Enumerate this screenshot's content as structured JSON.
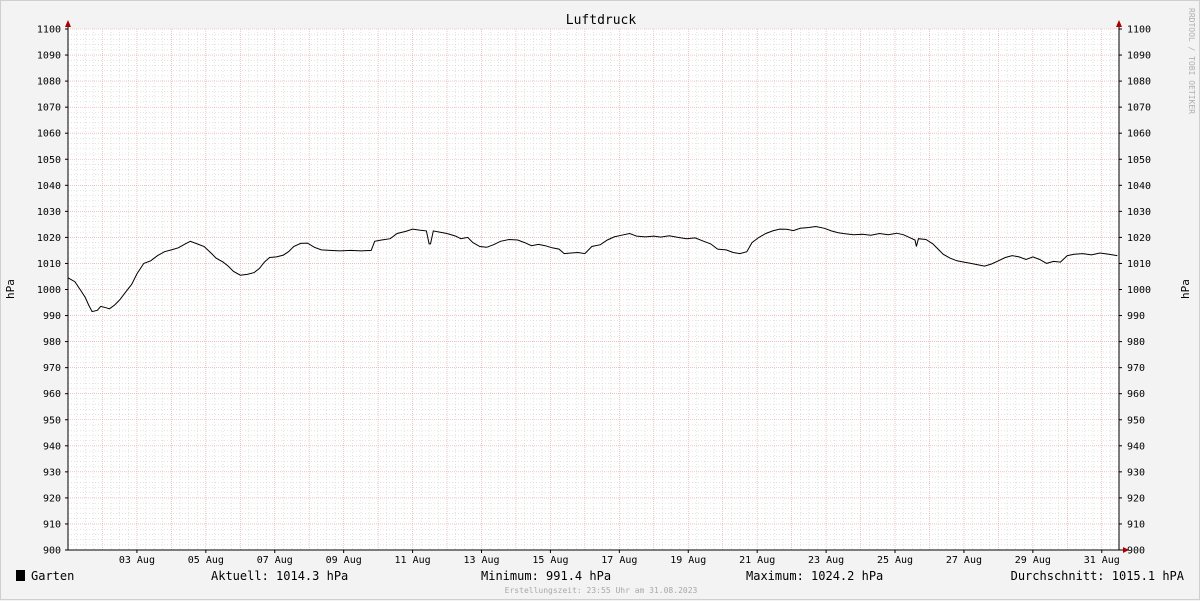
{
  "chart_data": {
    "type": "line",
    "title": "Luftdruck",
    "ylabel_left": "hPa",
    "ylabel_right": "hPa",
    "ylim": [
      900,
      1100
    ],
    "y_ticks": [
      900,
      910,
      920,
      930,
      940,
      950,
      960,
      970,
      980,
      990,
      1000,
      1010,
      1020,
      1030,
      1040,
      1050,
      1060,
      1070,
      1080,
      1090,
      1100
    ],
    "x_ticks": [
      {
        "day": 3,
        "label": "03 Aug"
      },
      {
        "day": 5,
        "label": "05 Aug"
      },
      {
        "day": 7,
        "label": "07 Aug"
      },
      {
        "day": 9,
        "label": "09 Aug"
      },
      {
        "day": 11,
        "label": "11 Aug"
      },
      {
        "day": 13,
        "label": "13 Aug"
      },
      {
        "day": 15,
        "label": "15 Aug"
      },
      {
        "day": 17,
        "label": "17 Aug"
      },
      {
        "day": 19,
        "label": "19 Aug"
      },
      {
        "day": 21,
        "label": "21 Aug"
      },
      {
        "day": 23,
        "label": "23 Aug"
      },
      {
        "day": 25,
        "label": "25 Aug"
      },
      {
        "day": 27,
        "label": "27 Aug"
      },
      {
        "day": 29,
        "label": "29 Aug"
      },
      {
        "day": 31,
        "label": "31 Aug"
      }
    ],
    "xlim_days": [
      1.0,
      31.5
    ],
    "grid": true,
    "series": [
      {
        "name": "Garten",
        "color": "#000000",
        "points": [
          [
            1.0,
            1004.5
          ],
          [
            1.2,
            1003
          ],
          [
            1.35,
            1000
          ],
          [
            1.5,
            997
          ],
          [
            1.6,
            994
          ],
          [
            1.7,
            991.5
          ],
          [
            1.85,
            992
          ],
          [
            1.95,
            993.5
          ],
          [
            2.1,
            993
          ],
          [
            2.2,
            992.6
          ],
          [
            2.35,
            994
          ],
          [
            2.5,
            996
          ],
          [
            2.7,
            999.5
          ],
          [
            2.85,
            1002
          ],
          [
            3.0,
            1006
          ],
          [
            3.2,
            1010
          ],
          [
            3.4,
            1011
          ],
          [
            3.6,
            1013
          ],
          [
            3.8,
            1014.5
          ],
          [
            4.0,
            1015.2
          ],
          [
            4.2,
            1016
          ],
          [
            4.4,
            1017.5
          ],
          [
            4.55,
            1018.5
          ],
          [
            4.75,
            1017.5
          ],
          [
            4.95,
            1016.5
          ],
          [
            5.15,
            1014
          ],
          [
            5.3,
            1012
          ],
          [
            5.5,
            1010.5
          ],
          [
            5.65,
            1009
          ],
          [
            5.8,
            1007
          ],
          [
            6.0,
            1005.5
          ],
          [
            6.2,
            1005.8
          ],
          [
            6.4,
            1006.5
          ],
          [
            6.55,
            1008
          ],
          [
            6.7,
            1010.5
          ],
          [
            6.85,
            1012.3
          ],
          [
            7.05,
            1012.5
          ],
          [
            7.25,
            1013.2
          ],
          [
            7.4,
            1014.5
          ],
          [
            7.55,
            1016.5
          ],
          [
            7.75,
            1017.7
          ],
          [
            7.95,
            1017.8
          ],
          [
            8.15,
            1016.2
          ],
          [
            8.35,
            1015.2
          ],
          [
            8.6,
            1015.0
          ],
          [
            8.9,
            1014.8
          ],
          [
            9.2,
            1015
          ],
          [
            9.5,
            1014.8
          ],
          [
            9.8,
            1015
          ],
          [
            9.9,
            1018.5
          ],
          [
            10.1,
            1019
          ],
          [
            10.35,
            1019.5
          ],
          [
            10.55,
            1021.5
          ],
          [
            10.8,
            1022.3
          ],
          [
            11.0,
            1023.2
          ],
          [
            11.2,
            1022.8
          ],
          [
            11.4,
            1022.5
          ],
          [
            11.48,
            1017.5
          ],
          [
            11.52,
            1017.5
          ],
          [
            11.6,
            1022.5
          ],
          [
            11.8,
            1022
          ],
          [
            12.0,
            1021.5
          ],
          [
            12.25,
            1020.5
          ],
          [
            12.4,
            1019.5
          ],
          [
            12.6,
            1020
          ],
          [
            12.75,
            1018
          ],
          [
            12.95,
            1016.5
          ],
          [
            13.15,
            1016.2
          ],
          [
            13.35,
            1017.2
          ],
          [
            13.55,
            1018.5
          ],
          [
            13.8,
            1019.2
          ],
          [
            14.05,
            1019.0
          ],
          [
            14.25,
            1018
          ],
          [
            14.45,
            1016.8
          ],
          [
            14.65,
            1017.3
          ],
          [
            14.85,
            1016.8
          ],
          [
            15.05,
            1016
          ],
          [
            15.25,
            1015.5
          ],
          [
            15.4,
            1013.8
          ],
          [
            15.6,
            1014
          ],
          [
            15.8,
            1014.2
          ],
          [
            16.0,
            1013.8
          ],
          [
            16.2,
            1016.5
          ],
          [
            16.45,
            1017.2
          ],
          [
            16.65,
            1019
          ],
          [
            16.85,
            1020.2
          ],
          [
            17.05,
            1020.8
          ],
          [
            17.3,
            1021.5
          ],
          [
            17.5,
            1020.5
          ],
          [
            17.75,
            1020.2
          ],
          [
            18.0,
            1020.5
          ],
          [
            18.2,
            1020.1
          ],
          [
            18.45,
            1020.6
          ],
          [
            18.7,
            1020
          ],
          [
            18.95,
            1019.5
          ],
          [
            19.2,
            1019.8
          ],
          [
            19.45,
            1018.5
          ],
          [
            19.65,
            1017.5
          ],
          [
            19.85,
            1015.5
          ],
          [
            20.1,
            1015.2
          ],
          [
            20.3,
            1014.2
          ],
          [
            20.5,
            1013.8
          ],
          [
            20.7,
            1014.5
          ],
          [
            20.85,
            1018
          ],
          [
            21.05,
            1020
          ],
          [
            21.25,
            1021.5
          ],
          [
            21.45,
            1022.5
          ],
          [
            21.65,
            1023.2
          ],
          [
            21.85,
            1023.1
          ],
          [
            22.05,
            1022.6
          ],
          [
            22.25,
            1023.5
          ],
          [
            22.5,
            1023.8
          ],
          [
            22.7,
            1024.2
          ],
          [
            22.95,
            1023.5
          ],
          [
            23.15,
            1022.5
          ],
          [
            23.35,
            1021.8
          ],
          [
            23.55,
            1021.4
          ],
          [
            23.8,
            1021
          ],
          [
            24.05,
            1021.2
          ],
          [
            24.3,
            1020.8
          ],
          [
            24.55,
            1021.5
          ],
          [
            24.8,
            1021
          ],
          [
            25.05,
            1021.6
          ],
          [
            25.25,
            1021
          ],
          [
            25.45,
            1019.8
          ],
          [
            25.58,
            1019
          ],
          [
            25.62,
            1016.5
          ],
          [
            25.68,
            1019.5
          ],
          [
            25.9,
            1019.2
          ],
          [
            26.1,
            1017.5
          ],
          [
            26.25,
            1015.5
          ],
          [
            26.4,
            1013.5
          ],
          [
            26.6,
            1012
          ],
          [
            26.8,
            1011
          ],
          [
            27.0,
            1010.5
          ],
          [
            27.2,
            1010
          ],
          [
            27.4,
            1009.5
          ],
          [
            27.6,
            1009
          ],
          [
            27.8,
            1009.8
          ],
          [
            28.0,
            1011
          ],
          [
            28.2,
            1012.3
          ],
          [
            28.4,
            1013
          ],
          [
            28.6,
            1012.5
          ],
          [
            28.8,
            1011.5
          ],
          [
            29.0,
            1012.5
          ],
          [
            29.2,
            1011.5
          ],
          [
            29.4,
            1010
          ],
          [
            29.6,
            1010.8
          ],
          [
            29.8,
            1010.5
          ],
          [
            30.0,
            1013
          ],
          [
            30.2,
            1013.5
          ],
          [
            30.45,
            1013.8
          ],
          [
            30.7,
            1013.3
          ],
          [
            30.95,
            1014
          ],
          [
            31.2,
            1013.5
          ],
          [
            31.45,
            1013
          ]
        ]
      }
    ]
  },
  "legend": {
    "series_name": "Garten",
    "swatch_color": "#000000",
    "current": "Aktuell: 1014.3 hPa",
    "minimum": "Minimum: 991.4 hPa",
    "maximum": "Maximum: 1024.2 hPa",
    "average": "Durchschnitt: 1015.1 hPA"
  },
  "footer": "Erstellungszeit: 23:55 Uhr am 31.08.2023",
  "side_credit": "RRDTOOL / TOBI OETIKER",
  "colors": {
    "background": "#f3f3f3",
    "plot_background": "#ffffff",
    "major_grid": "#e8a0a0",
    "minor_grid": "#c8c8c8",
    "axis": "#000000",
    "arrow": "#aa0000"
  }
}
